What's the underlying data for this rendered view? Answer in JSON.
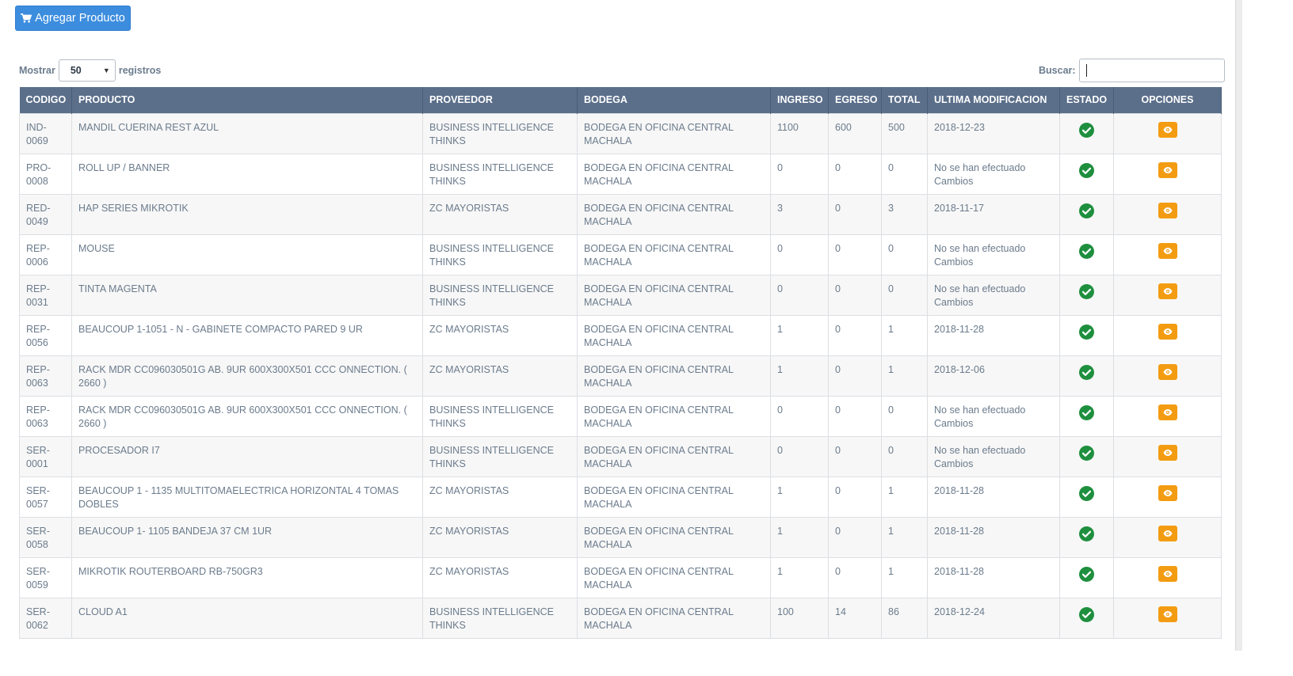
{
  "toolbar": {
    "add_label": "Agregar Producto"
  },
  "length": {
    "prefix": "Mostrar",
    "value": "50",
    "suffix": "registros"
  },
  "search": {
    "label": "Buscar:",
    "value": ""
  },
  "colors": {
    "header_bg": "#5b6f8a",
    "primary": "#3c8dde",
    "success": "#1e8f3e",
    "warning": "#f39c12"
  },
  "table": {
    "headers": [
      "CODIGO",
      "PRODUCTO",
      "PROVEEDOR",
      "BODEGA",
      "INGRESO",
      "EGRESO",
      "TOTAL",
      "ULTIMA MODIFICACION",
      "ESTADO",
      "OPCIONES"
    ],
    "rows": [
      {
        "codigo": "IND-0069",
        "producto": "MANDIL CUERINA REST AZUL",
        "proveedor": "BUSINESS INTELLIGENCE THINKS",
        "bodega": "BODEGA EN OFICINA CENTRAL MACHALA",
        "ingreso": "1100",
        "egreso": "600",
        "total": "500",
        "modificacion": "2018-12-23"
      },
      {
        "codigo": "PRO-0008",
        "producto": "ROLL UP / BANNER",
        "proveedor": "BUSINESS INTELLIGENCE THINKS",
        "bodega": "BODEGA EN OFICINA CENTRAL MACHALA",
        "ingreso": "0",
        "egreso": "0",
        "total": "0",
        "modificacion": "No se han efectuado Cambios"
      },
      {
        "codigo": "RED-0049",
        "producto": "HAP SERIES MIKROTIK",
        "proveedor": "ZC MAYORISTAS",
        "bodega": "BODEGA EN OFICINA CENTRAL MACHALA",
        "ingreso": "3",
        "egreso": "0",
        "total": "3",
        "modificacion": "2018-11-17"
      },
      {
        "codigo": "REP-0006",
        "producto": "MOUSE",
        "proveedor": "BUSINESS INTELLIGENCE THINKS",
        "bodega": "BODEGA EN OFICINA CENTRAL MACHALA",
        "ingreso": "0",
        "egreso": "0",
        "total": "0",
        "modificacion": "No se han efectuado Cambios"
      },
      {
        "codigo": "REP-0031",
        "producto": "TINTA MAGENTA",
        "proveedor": "BUSINESS INTELLIGENCE THINKS",
        "bodega": "BODEGA EN OFICINA CENTRAL MACHALA",
        "ingreso": "0",
        "egreso": "0",
        "total": "0",
        "modificacion": "No se han efectuado Cambios"
      },
      {
        "codigo": "REP-0056",
        "producto": "BEAUCOUP 1-1051 - N - GABINETE COMPACTO PARED 9 UR",
        "proveedor": "ZC MAYORISTAS",
        "bodega": "BODEGA EN OFICINA CENTRAL MACHALA",
        "ingreso": "1",
        "egreso": "0",
        "total": "1",
        "modificacion": "2018-11-28"
      },
      {
        "codigo": "REP-0063",
        "producto": "RACK MDR CC096030501G AB. 9UR 600X300X501 CCC ONNECTION. ( 2660 )",
        "proveedor": "ZC MAYORISTAS",
        "bodega": "BODEGA EN OFICINA CENTRAL MACHALA",
        "ingreso": "1",
        "egreso": "0",
        "total": "1",
        "modificacion": "2018-12-06"
      },
      {
        "codigo": "REP-0063",
        "producto": "RACK MDR CC096030501G AB. 9UR 600X300X501 CCC ONNECTION. ( 2660 )",
        "proveedor": "BUSINESS INTELLIGENCE THINKS",
        "bodega": "BODEGA EN OFICINA CENTRAL MACHALA",
        "ingreso": "0",
        "egreso": "0",
        "total": "0",
        "modificacion": "No se han efectuado Cambios"
      },
      {
        "codigo": "SER-0001",
        "producto": "PROCESADOR I7",
        "proveedor": "BUSINESS INTELLIGENCE THINKS",
        "bodega": "BODEGA EN OFICINA CENTRAL MACHALA",
        "ingreso": "0",
        "egreso": "0",
        "total": "0",
        "modificacion": "No se han efectuado Cambios"
      },
      {
        "codigo": "SER-0057",
        "producto": "BEAUCOUP 1 - 1135 MULTITOMAELECTRICA HORIZONTAL 4 TOMAS DOBLES",
        "proveedor": "ZC MAYORISTAS",
        "bodega": "BODEGA EN OFICINA CENTRAL MACHALA",
        "ingreso": "1",
        "egreso": "0",
        "total": "1",
        "modificacion": "2018-11-28"
      },
      {
        "codigo": "SER-0058",
        "producto": "BEAUCOUP 1- 1105 BANDEJA 37 CM 1UR",
        "proveedor": "ZC MAYORISTAS",
        "bodega": "BODEGA EN OFICINA CENTRAL MACHALA",
        "ingreso": "1",
        "egreso": "0",
        "total": "1",
        "modificacion": "2018-11-28"
      },
      {
        "codigo": "SER-0059",
        "producto": "MIKROTIK ROUTERBOARD RB-750GR3",
        "proveedor": "ZC MAYORISTAS",
        "bodega": "BODEGA EN OFICINA CENTRAL MACHALA",
        "ingreso": "1",
        "egreso": "0",
        "total": "1",
        "modificacion": "2018-11-28"
      },
      {
        "codigo": "SER-0062",
        "producto": "CLOUD A1",
        "proveedor": "BUSINESS INTELLIGENCE THINKS",
        "bodega": "BODEGA EN OFICINA CENTRAL MACHALA",
        "ingreso": "100",
        "egreso": "14",
        "total": "86",
        "modificacion": "2018-12-24"
      }
    ]
  }
}
